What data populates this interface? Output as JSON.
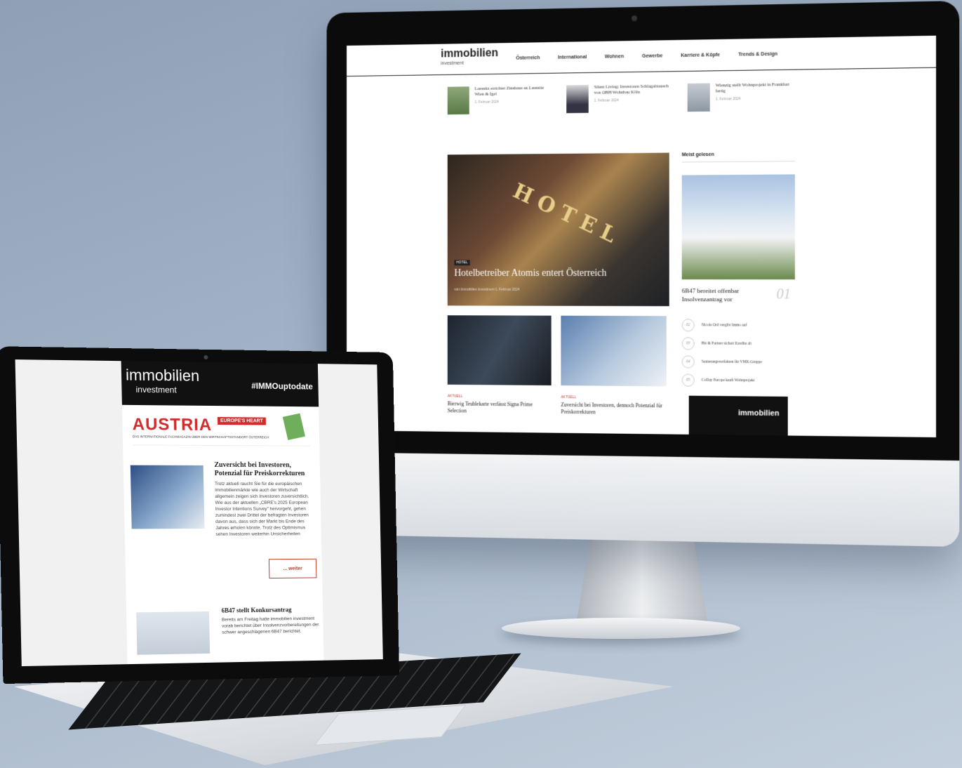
{
  "imac": {
    "brand": "immobilien",
    "brand_sub": "investment",
    "nav": [
      "Österreich",
      "International",
      "Wohnen",
      "Gewerbe",
      "Karriere & Köpfe",
      "Trends & Design"
    ],
    "ticker": [
      {
        "title": "Lassnitz errichtet Zinshaus an Lassnitz Wien & Igel",
        "date": "1. Februar 2024"
      },
      {
        "title": "Silent Living: Investoren Schlagabtausch von OBH Wohnbau Köln",
        "date": "1. Februar 2024"
      },
      {
        "title": "Wienzig stellt Wohnprojekt in Frankfurt fertig",
        "date": "1. Februar 2024"
      }
    ],
    "hero": {
      "sign": "HOTEL",
      "tag": "HOTEL",
      "title": "Hotelbetreiber Atomis entert Österreich",
      "meta": "von immobilien investment   1. Februar 2024"
    },
    "cards": [
      {
        "tag": "AKTUELL",
        "title": "Bierwig Teublekarte verlässt Signa Prime Selection"
      },
      {
        "tag": "AKTUELL",
        "title": "Zuversicht bei Investoren, dennoch Potenzial für Preiskorrekturen"
      }
    ],
    "sidebar": {
      "head": "Meist gelesen",
      "top_title": "6B47 bereitet offenbar Insolvenzantrag vor",
      "top_num": "01",
      "items": [
        {
          "n": "02",
          "t": "Nicole Ord vergibt Immo auf"
        },
        {
          "n": "03",
          "t": "Bis & Partner sichert Kredite ab"
        },
        {
          "n": "04",
          "t": "Sanierungsverfahren für VMK-Gruppe"
        },
        {
          "n": "05",
          "t": "CoDay Europe kauft Wohnprojekt"
        }
      ],
      "ad": "immobilien"
    }
  },
  "laptop": {
    "brand": "immobilien",
    "brand_sub": "investment",
    "hashtag": "#IMMOuptodate",
    "banner": {
      "big": "AUSTRIA",
      "ep": "EUROPE'S HEART",
      "sub": "DAS INTERNATIONALE FACHMAGAZIN ÜBER DEN WIRTSCHAFTSSTANDORT ÖSTERREICH"
    },
    "article1": {
      "title": "Zuversicht bei Investoren, Potenzial für Preiskorrekturen",
      "text": "Trotz aktuell raucht Sie für die europäischen Immobilienmärkte wie auch der Wirtschaft allgemein zeigen sich Investoren zuversichtlich. Wie aus der aktuellen „CBRE's 2025 European Investor Intentions Survey\" hervorgeht, gehen zumindest zwei Drittel der befragten Investoren davon aus, dass sich der Markt bis Ende des Jahres erholen könnte. Trotz des Optimismus sehen Investoren weiterhin Unsicherheiten",
      "more": "... weiter"
    },
    "article2": {
      "title": "6B47 stellt Konkursantrag",
      "text": "Bereits am Freitag hatte immobilien investment vorab berichtet über Insolvenzvorbereitungen der schwer angeschlagenen 6B47 berichtet."
    }
  }
}
